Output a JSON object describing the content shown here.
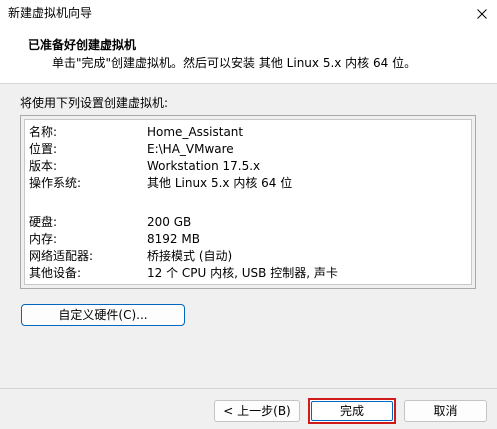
{
  "window": {
    "title": "新建虚拟机向导"
  },
  "header": {
    "title": "已准备好创建虚拟机",
    "subtitle": "单击\"完成\"创建虚拟机。然后可以安装 其他 Linux 5.x 内核 64 位。"
  },
  "intro": "将使用下列设置创建虚拟机:",
  "summary": {
    "rows": [
      {
        "label": "名称:",
        "value": "Home_Assistant"
      },
      {
        "label": "位置:",
        "value": "E:\\HA_VMware"
      },
      {
        "label": "版本:",
        "value": "Workstation 17.5.x"
      },
      {
        "label": "操作系统:",
        "value": "其他 Linux 5.x 内核 64 位"
      },
      {
        "label": "",
        "value": ""
      },
      {
        "label": "硬盘:",
        "value": "200 GB"
      },
      {
        "label": "内存:",
        "value": "8192 MB"
      },
      {
        "label": "网络适配器:",
        "value": "桥接模式 (自动)"
      },
      {
        "label": "其他设备:",
        "value": "12 个 CPU 内核, USB 控制器, 声卡"
      }
    ]
  },
  "buttons": {
    "customize": "自定义硬件(C)...",
    "back": "< 上一步(B)",
    "finish": "完成",
    "cancel": "取消"
  },
  "icons": {
    "close": "close-icon"
  },
  "colors": {
    "accent": "#0067c0",
    "highlight_border": "#d11a1a"
  }
}
